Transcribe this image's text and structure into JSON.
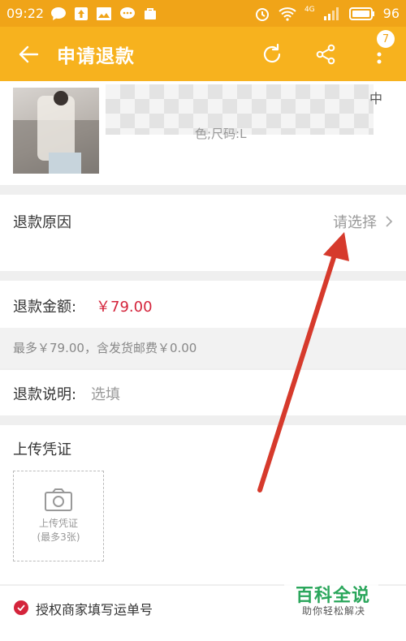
{
  "status_bar": {
    "time": "09:22",
    "network": "4G",
    "battery": "96"
  },
  "app_bar": {
    "title": "申请退款",
    "badge_count": "7"
  },
  "product": {
    "name_tail": "中",
    "sub": "色;尺码:L"
  },
  "reason": {
    "label": "退款原因",
    "placeholder": "请选择"
  },
  "amount": {
    "label": "退款金额:",
    "value": "￥79.00"
  },
  "hint": {
    "text": "最多￥79.00，含发货邮费￥0.00"
  },
  "description": {
    "label": "退款说明:",
    "placeholder": "选填"
  },
  "upload": {
    "label": "上传凭证",
    "box_line1": "上传凭证",
    "box_line2": "(最多3张)"
  },
  "auth": {
    "label": "授权商家填写运单号"
  },
  "watermark": {
    "title": "百科全说",
    "subtitle": "助你轻松解决"
  },
  "colors": {
    "accent": "#f7b21e",
    "price": "#d4243b",
    "arrow": "#d63a2c",
    "watermark": "#2aa65b"
  }
}
